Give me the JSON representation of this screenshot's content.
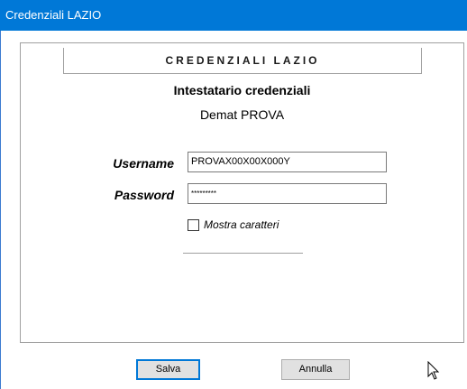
{
  "window": {
    "title": "Credenziali LAZIO"
  },
  "panel": {
    "header": "CREDENZIALI LAZIO",
    "subtitle": "Intestatario credenziali",
    "owner": "Demat PROVA"
  },
  "form": {
    "username_label": "Username",
    "username_value": "PROVAX00X00X000Y",
    "password_label": "Password",
    "password_value": "*********",
    "show_chars_label": "Mostra caratteri",
    "show_chars_checked": false
  },
  "buttons": {
    "save_label": "Salva",
    "cancel_label": "Annulla"
  },
  "icons": {
    "cursor": "mouse-pointer-icon"
  },
  "colors": {
    "titlebar": "#0078d7",
    "focus_border": "#0078d7"
  }
}
